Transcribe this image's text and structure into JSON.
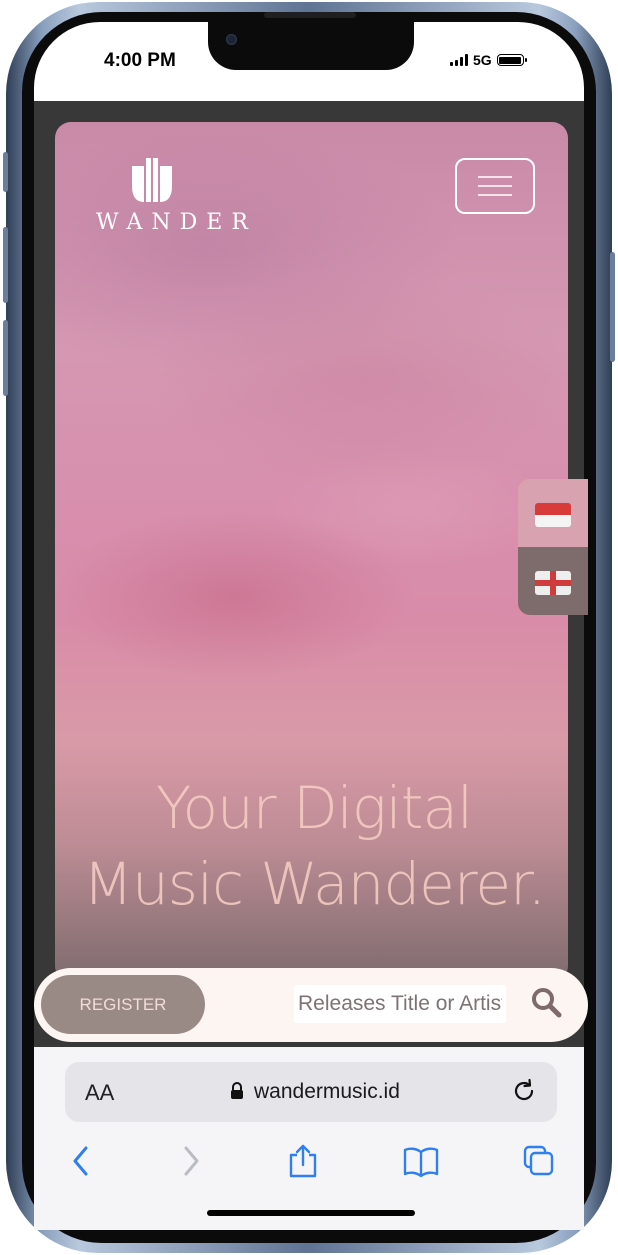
{
  "status_bar": {
    "time": "4:00 PM",
    "network": "5G"
  },
  "site": {
    "logo_text": "WANDER",
    "headline_line1": "Your Digital",
    "headline_line2": "Music Wanderer.",
    "languages": [
      {
        "code": "id",
        "icon": "indonesia-flag-icon"
      },
      {
        "code": "en",
        "icon": "england-flag-icon"
      }
    ],
    "register_label": "REGISTER",
    "search_placeholder": "Releases Title or Artist"
  },
  "browser": {
    "text_size_label": "AA",
    "url": "wandermusic.id",
    "toolbar_icons": [
      "back-icon",
      "forward-icon",
      "share-icon",
      "bookmarks-icon",
      "tabs-icon"
    ]
  },
  "colors": {
    "hero_pink": "#d78fad",
    "accent_brown": "#9a8a86",
    "headline_peach": "#f5cdc3",
    "safari_blue": "#2f7ff0"
  }
}
